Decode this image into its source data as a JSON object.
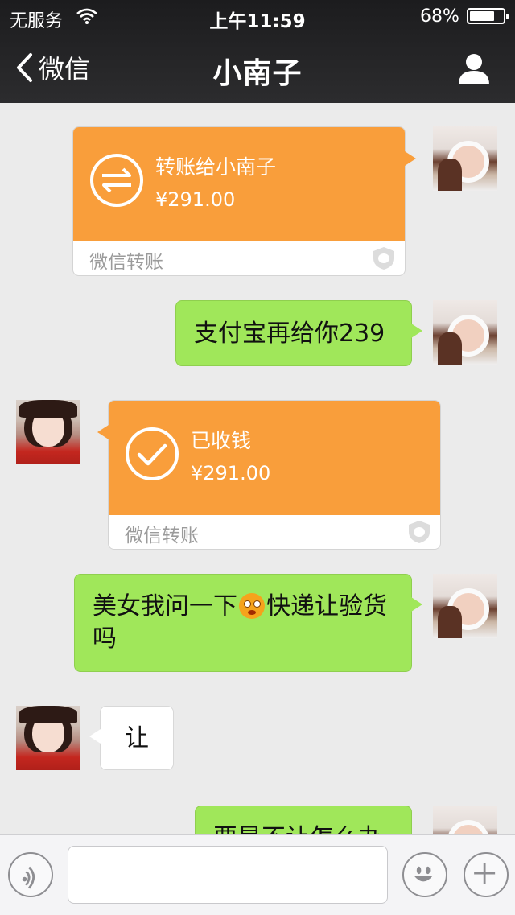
{
  "status": {
    "carrier": "无服务",
    "time": "上午11:59",
    "battery": "68%",
    "battery_level": 0.68
  },
  "nav": {
    "back_label": "微信",
    "title": "小南子"
  },
  "messages": {
    "m1": {
      "title": "转账给小南子",
      "amount": "¥291.00",
      "footer": "微信转账"
    },
    "m2": {
      "text": "支付宝再给你239"
    },
    "m3": {
      "title": "已收钱",
      "amount": "¥291.00",
      "footer": "微信转账"
    },
    "m4": {
      "text_before": "美女我问一下",
      "text_after": "快递让验货吗"
    },
    "m5": {
      "text": "让"
    },
    "m6": {
      "text": "要是不让怎么办"
    }
  },
  "input": {
    "placeholder": "",
    "value": ""
  },
  "colors": {
    "transfer_orange": "#f99e3b",
    "bubble_green": "#a0e75a",
    "nav_bg": "#1c1c1e",
    "chat_bg": "#ebebeb"
  },
  "icons": [
    "wifi-icon",
    "battery-icon",
    "back-chevron-icon",
    "profile-icon",
    "transfer-arrows-icon",
    "checkmark-circle-icon",
    "shield-icon",
    "voice-icon",
    "emoji-face-icon",
    "plus-icon"
  ]
}
